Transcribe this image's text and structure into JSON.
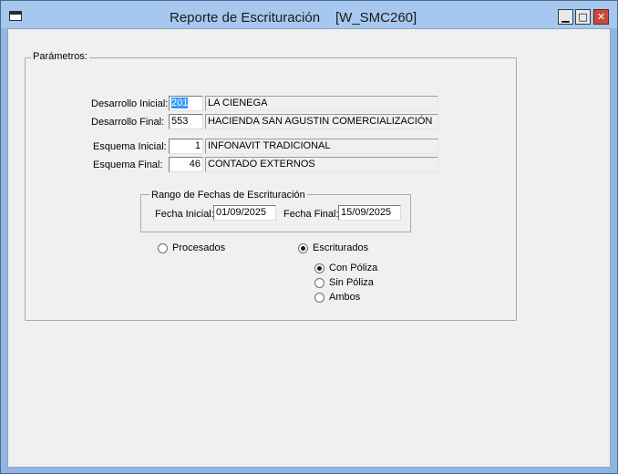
{
  "window": {
    "title": "Reporte de Escrituración",
    "code": "[W_SMC260]",
    "buttons": {
      "minimize": "▁",
      "maximize": "□",
      "close": "✕"
    }
  },
  "parametros": {
    "label": "Parámetros:",
    "desarrollo_inicial": {
      "label": "Desarrollo Inicial:",
      "code": "201",
      "name": "LA CIENEGA"
    },
    "desarrollo_final": {
      "label": "Desarrollo Final:",
      "code": "553",
      "name": "HACIENDA SAN AGUSTIN COMERCIALIZACIÓN"
    },
    "esquema_inicial": {
      "label": "Esquema Inicial:",
      "code": "1",
      "name": "INFONAVIT TRADICIONAL"
    },
    "esquema_final": {
      "label": "Esquema Final:",
      "code": "46",
      "name": "CONTADO EXTERNOS"
    }
  },
  "rango_fechas": {
    "label": "Rango de Fechas de Escrituración",
    "fecha_inicial": {
      "label": "Fecha Inicial:",
      "value": "01/09/2025"
    },
    "fecha_final": {
      "label": "Fecha Final:",
      "value": "15/09/2025"
    }
  },
  "estado": {
    "procesados": {
      "label": "Procesados",
      "selected": false
    },
    "escriturados": {
      "label": "Escriturados",
      "selected": true
    }
  },
  "poliza": {
    "con_poliza": {
      "label": "Con Póliza",
      "selected": true
    },
    "sin_poliza": {
      "label": "Sin Póliza",
      "selected": false
    },
    "ambos": {
      "label": "Ambos",
      "selected": false
    }
  }
}
